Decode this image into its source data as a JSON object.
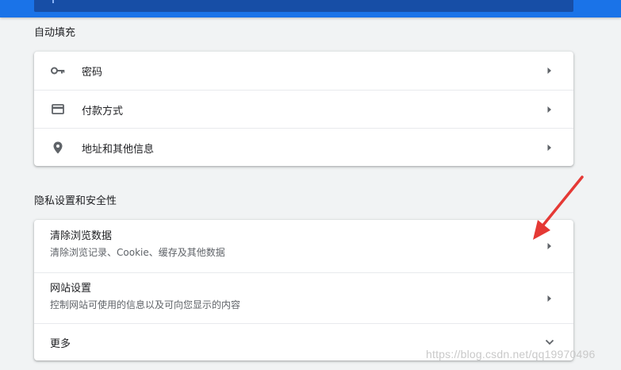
{
  "autofill": {
    "title": "自动填充",
    "items": [
      {
        "label": "密码",
        "icon": "key-icon"
      },
      {
        "label": "付款方式",
        "icon": "credit-card-icon"
      },
      {
        "label": "地址和其他信息",
        "icon": "location-pin-icon"
      }
    ]
  },
  "privacy": {
    "title": "隐私设置和安全性",
    "items": [
      {
        "label": "清除浏览数据",
        "sublabel": "清除浏览记录、Cookie、缓存及其他数据"
      },
      {
        "label": "网站设置",
        "sublabel": "控制网站可使用的信息以及可向您显示的内容"
      },
      {
        "label": "更多"
      }
    ]
  },
  "watermark": "https://blog.csdn.net/qq19970496",
  "colors": {
    "header": "#1a73e8",
    "annotation": "#e53935"
  }
}
